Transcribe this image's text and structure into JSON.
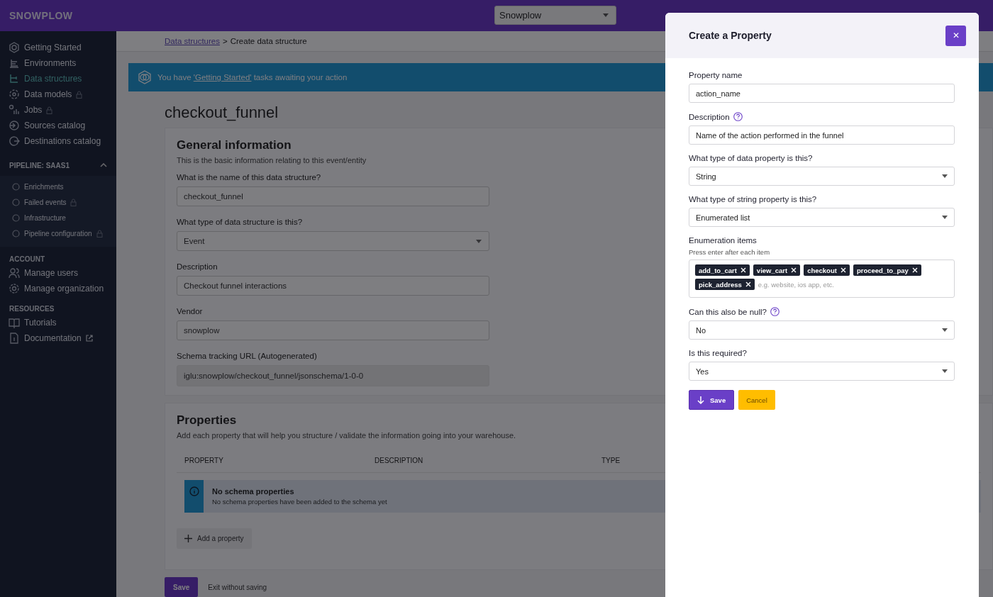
{
  "header": {
    "logo": "SNOWPLOW",
    "org_select": "Snowplow"
  },
  "sidebar": {
    "items": [
      {
        "label": "Getting Started",
        "selected": false,
        "locked": false
      },
      {
        "label": "Environments",
        "selected": false,
        "locked": false
      },
      {
        "label": "Data structures",
        "selected": true,
        "locked": false
      },
      {
        "label": "Data models",
        "selected": false,
        "locked": true
      },
      {
        "label": "Jobs",
        "selected": false,
        "locked": true
      },
      {
        "label": "Sources catalog",
        "selected": false,
        "locked": false
      },
      {
        "label": "Destinations catalog",
        "selected": false,
        "locked": false
      }
    ],
    "pipeline": {
      "title": "PIPELINE: SAAS1",
      "expanded": true,
      "items": [
        {
          "label": "Enrichments",
          "locked": false
        },
        {
          "label": "Failed events",
          "locked": true
        },
        {
          "label": "Infrastructure",
          "locked": false
        },
        {
          "label": "Pipeline configuration",
          "locked": true
        }
      ]
    },
    "sections": [
      {
        "title": "ACCOUNT",
        "items": [
          {
            "label": "Manage users",
            "external": false
          },
          {
            "label": "Manage organization",
            "external": false
          }
        ]
      },
      {
        "title": "RESOURCES",
        "items": [
          {
            "label": "Tutorials",
            "external": false
          },
          {
            "label": "Documentation",
            "external": true
          }
        ]
      }
    ]
  },
  "breadcrumb": {
    "link": "Data structures",
    "separator": ">",
    "current": "Create data structure"
  },
  "banner": {
    "before": "You have ",
    "link": "'Getting Started'",
    "after": " tasks awaiting your action"
  },
  "page_title": "checkout_funnel",
  "general": {
    "title": "General information",
    "subtitle": "This is the basic information relating to this event/entity",
    "fields": [
      {
        "label": "What is the name of this data structure?",
        "value": "checkout_funnel",
        "kind": "text"
      },
      {
        "label": "What type of data structure is this?",
        "value": "Event",
        "kind": "select"
      },
      {
        "label": "Description",
        "value": "Checkout funnel interactions",
        "kind": "text"
      },
      {
        "label": "Vendor",
        "value": "snowplow",
        "kind": "text"
      },
      {
        "label": "Schema tracking URL (Autogenerated)",
        "value": "iglu:snowplow/checkout_funnel/jsonschema/1-0-0",
        "kind": "readonly"
      }
    ]
  },
  "properties": {
    "title": "Properties",
    "subtitle": "Add each property that will help you structure / validate the information going into your warehouse.",
    "columns": [
      "PROPERTY",
      "DESCRIPTION",
      "TYPE"
    ],
    "empty": {
      "title": "No schema properties",
      "text": "No schema properties have been added to the schema yet"
    },
    "add_button": "Add a property"
  },
  "footer": {
    "save": "Save",
    "exit": "Exit without saving"
  },
  "modal": {
    "title": "Create a Property",
    "close": "✕",
    "fields": [
      {
        "label": "Property name",
        "help": false,
        "kind": "text",
        "value": "action_name"
      },
      {
        "label": "Description",
        "help": true,
        "kind": "text",
        "value": "Name of the action performed in the funnel"
      },
      {
        "label": "What type of data property is this?",
        "help": false,
        "kind": "select",
        "value": "String"
      },
      {
        "label": "What type of string property is this?",
        "help": false,
        "kind": "select",
        "value": "Enumerated list"
      },
      {
        "label": "Enumeration items",
        "hint": "Press enter after each item",
        "help": false,
        "kind": "tags",
        "tags": [
          "add_to_cart",
          "view_cart",
          "checkout",
          "proceed_to_pay",
          "pick_address"
        ],
        "placeholder": "e.g. website, ios app, etc."
      },
      {
        "label": "Can this also be null?",
        "help": true,
        "kind": "select",
        "value": "No"
      },
      {
        "label": "Is this required?",
        "help": false,
        "kind": "select",
        "value": "Yes"
      }
    ],
    "save": "Save",
    "cancel": "Cancel"
  }
}
